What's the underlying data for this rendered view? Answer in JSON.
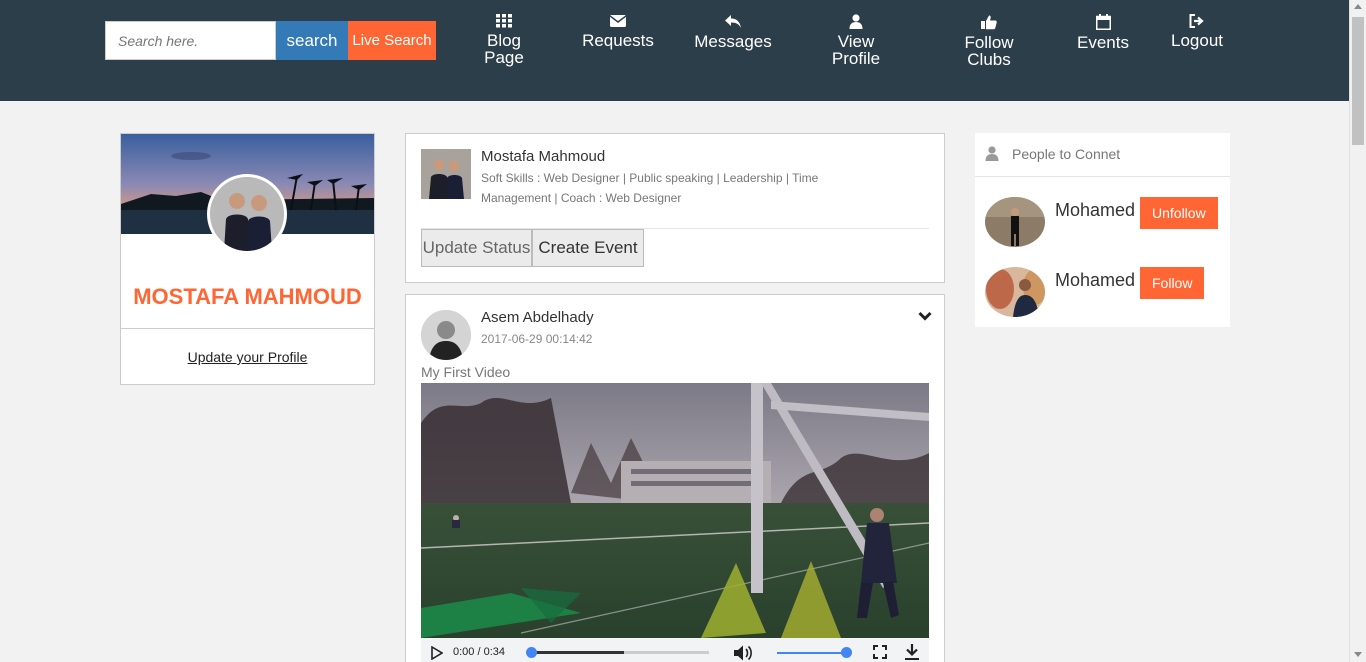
{
  "search": {
    "placeholder": "Search here.",
    "button_label": "search",
    "live_label": "Live Search"
  },
  "nav": {
    "items": [
      {
        "label_line1": "Blog",
        "label_line2": "Page",
        "icon": "grid-icon"
      },
      {
        "label_line1": "Requests",
        "label_line2": "",
        "icon": "envelope-icon"
      },
      {
        "label_line1": "Messages",
        "label_line2": "",
        "icon": "reply-icon"
      },
      {
        "label_line1": "View",
        "label_line2": "Profile",
        "icon": "user-icon"
      },
      {
        "label_line1": "Follow",
        "label_line2": "Clubs",
        "icon": "thumbs-up-icon"
      },
      {
        "label_line1": "Events",
        "label_line2": "",
        "icon": "calendar-icon"
      },
      {
        "label_line1": "Logout",
        "label_line2": "",
        "icon": "logout-icon"
      }
    ]
  },
  "profile": {
    "name": "MOSTAFA MAHMOUD",
    "update_link": "Update your Profile"
  },
  "status": {
    "name": "Mostafa Mahmoud",
    "skills_line1": "Soft Skills : Web Designer | Public speaking | Leadership | Time",
    "skills_line2": "Management | Coach : Web Designer",
    "update_status_label": "Update Status",
    "create_event_label": "Create Event"
  },
  "post": {
    "author": "Asem Abdelhady",
    "timestamp": "2017-06-29 00:14:42",
    "caption": "My First Video",
    "video": {
      "time": "0:00 / 0:34",
      "progress": 0,
      "volume": 1.0
    }
  },
  "people": {
    "title": "People to Connet",
    "items": [
      {
        "name": "Mohamed",
        "button": "Unfollow"
      },
      {
        "name": "Mohamed",
        "button": "Follow"
      }
    ]
  },
  "colors": {
    "nav_bg": "#2c3e4a",
    "accent": "#ff6633",
    "primary": "#337ab7",
    "page_bg": "#f2f2f2"
  }
}
